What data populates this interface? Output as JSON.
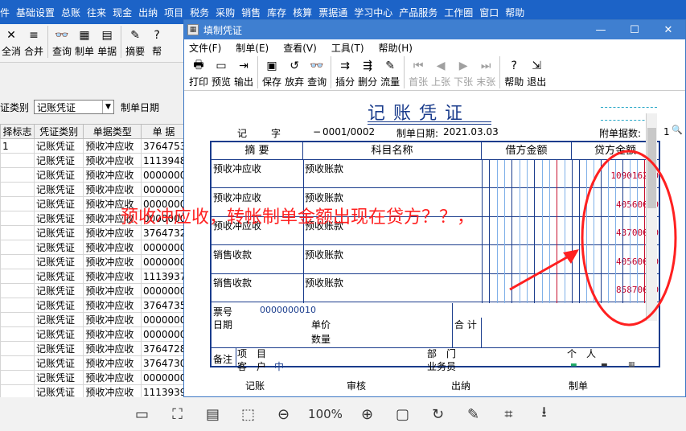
{
  "menubar": [
    "件",
    "基础设置",
    "总账",
    "往来",
    "现金",
    "出纳",
    "项目",
    "税务",
    "采购",
    "销售",
    "库存",
    "核算",
    "票据通",
    "学习中心",
    "产品服务",
    "工作圈",
    "窗口",
    "帮助"
  ],
  "bg_toolbar": [
    {
      "label": "全消",
      "icon": "✕"
    },
    {
      "label": "合并",
      "icon": "≡"
    },
    {
      "label": "查询",
      "icon": "👓"
    },
    {
      "label": "制单",
      "icon": "▦"
    },
    {
      "label": "单据",
      "icon": "▤"
    },
    {
      "label": "摘要",
      "icon": "✎"
    },
    {
      "label": "帮",
      "icon": "?"
    }
  ],
  "bg_filter": {
    "label1": "证类别",
    "select_value": "记账凭证",
    "label2": "制单日期"
  },
  "bg_table": {
    "headers": [
      "择标志",
      "凭证类别",
      "单据类型",
      "单 据"
    ],
    "rows": [
      [
        "1",
        "记账凭证",
        "预收冲应收",
        "3764753"
      ],
      [
        "",
        "记账凭证",
        "预收冲应收",
        "1113948"
      ],
      [
        "",
        "记账凭证",
        "预收冲应收",
        "0000000"
      ],
      [
        "",
        "记账凭证",
        "预收冲应收",
        "0000000"
      ],
      [
        "",
        "记账凭证",
        "预收冲应收",
        "0000000"
      ],
      [
        "",
        "记账凭证",
        "预收冲应收",
        "0000000"
      ],
      [
        "",
        "记账凭证",
        "预收冲应收",
        "3764732"
      ],
      [
        "",
        "记账凭证",
        "预收冲应收",
        "0000000"
      ],
      [
        "",
        "记账凭证",
        "预收冲应收",
        "0000000"
      ],
      [
        "",
        "记账凭证",
        "预收冲应收",
        "1113937"
      ],
      [
        "",
        "记账凭证",
        "预收冲应收",
        "0000000"
      ],
      [
        "",
        "记账凭证",
        "预收冲应收",
        "3764735"
      ],
      [
        "",
        "记账凭证",
        "预收冲应收",
        "0000000"
      ],
      [
        "",
        "记账凭证",
        "预收冲应收",
        "0000000"
      ],
      [
        "",
        "记账凭证",
        "预收冲应收",
        "3764728"
      ],
      [
        "",
        "记账凭证",
        "预收冲应收",
        "3764730"
      ],
      [
        "",
        "记账凭证",
        "预收冲应收",
        "0000000"
      ],
      [
        "",
        "记账凭证",
        "预收冲应收",
        "1113939"
      ]
    ]
  },
  "dialog": {
    "title": "填制凭证",
    "menu": [
      "文件(F)",
      "制单(E)",
      "查看(V)",
      "工具(T)",
      "帮助(H)"
    ],
    "toolbar": [
      {
        "label": "打印",
        "icon": "🖶",
        "disabled": false
      },
      {
        "label": "预览",
        "icon": "▭",
        "disabled": false
      },
      {
        "label": "输出",
        "icon": "⇥",
        "disabled": false
      },
      {
        "label": "保存",
        "icon": "▣",
        "disabled": false
      },
      {
        "label": "放弃",
        "icon": "↺",
        "disabled": false
      },
      {
        "label": "查询",
        "icon": "👓",
        "disabled": false
      },
      {
        "label": "插分",
        "icon": "⇉",
        "disabled": false
      },
      {
        "label": "删分",
        "icon": "⇶",
        "disabled": false
      },
      {
        "label": "流量",
        "icon": "✎",
        "disabled": false
      },
      {
        "label": "首张",
        "icon": "⏮",
        "disabled": true
      },
      {
        "label": "上张",
        "icon": "◀",
        "disabled": true
      },
      {
        "label": "下张",
        "icon": "▶",
        "disabled": true
      },
      {
        "label": "末张",
        "icon": "⏭",
        "disabled": true
      },
      {
        "label": "帮助",
        "icon": "?",
        "disabled": false
      },
      {
        "label": "退出",
        "icon": "⇲",
        "disabled": false
      }
    ]
  },
  "voucher": {
    "title": "记账凭证",
    "type_label": "记",
    "zi_label": "字",
    "number": "0001/0002",
    "date_label": "制单日期:",
    "date_value": "2021.03.03",
    "attach_label": "附单据数:",
    "attach_value": "1",
    "headers": {
      "summary": "摘 要",
      "account": "科目名称",
      "debit": "借方金额",
      "credit": "贷方金额"
    },
    "rows": [
      {
        "summary": "预收冲应收",
        "account": "预收账款",
        "credit": "109016250"
      },
      {
        "summary": "预收冲应收",
        "account": "预收账款",
        "credit": "40560000"
      },
      {
        "summary": "预收冲应收",
        "account": "预收账款",
        "credit": "43700000"
      },
      {
        "summary": "销售收款",
        "account": "预收账款",
        "credit": "40560000"
      },
      {
        "summary": "销售收款",
        "account": "预收账款",
        "credit": "85870000"
      }
    ],
    "footer": {
      "ticket_label": "票号",
      "ticket_value": "0000000010",
      "date_label": "日期",
      "price_label": "单价",
      "qty_label": "数量",
      "total_label": "合 计",
      "note_label": "备注",
      "project_label": "项　目",
      "customer_label": "客　户",
      "customer_value": "中",
      "dept_label": "部　门",
      "person_label": "个　人",
      "salesman_label": "业务员"
    },
    "sign": {
      "bookkeep": "记账",
      "audit": "审核",
      "cashier": "出纳",
      "maker": "制单"
    }
  },
  "annotation": {
    "text": "预收冲应收，转帐制单金额出现在贷方？？，",
    "color": "#ff2020"
  },
  "viewer": {
    "zoom": "100%"
  }
}
